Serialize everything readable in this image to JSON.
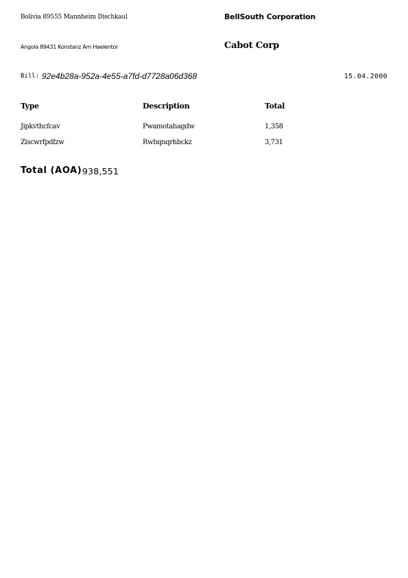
{
  "sender": {
    "address": "Bolivia 89555 Mannheim Dischkaul",
    "company": "BellSouth Corporation"
  },
  "recipient": {
    "address": "Angola 89431 Konstanz Am Haelentor",
    "company": "Cabot Corp"
  },
  "bill": {
    "label": "Bill:",
    "id": "92e4b28a-952a-4e55-a7fd-d7728a06d368",
    "date": "15.04.2000"
  },
  "table": {
    "headers": [
      "Type",
      "Description",
      "Total"
    ],
    "rows": [
      {
        "type": "Jipkvthcfcav",
        "description": "Pwamotahagdw",
        "total": "1,358"
      },
      {
        "type": "Ziscwrfpdfzw",
        "description": "Rwhqnqrhbckz",
        "total": "3,731"
      }
    ]
  },
  "summary": {
    "total_label": "Total (AOA)",
    "total_value": "938,551"
  }
}
